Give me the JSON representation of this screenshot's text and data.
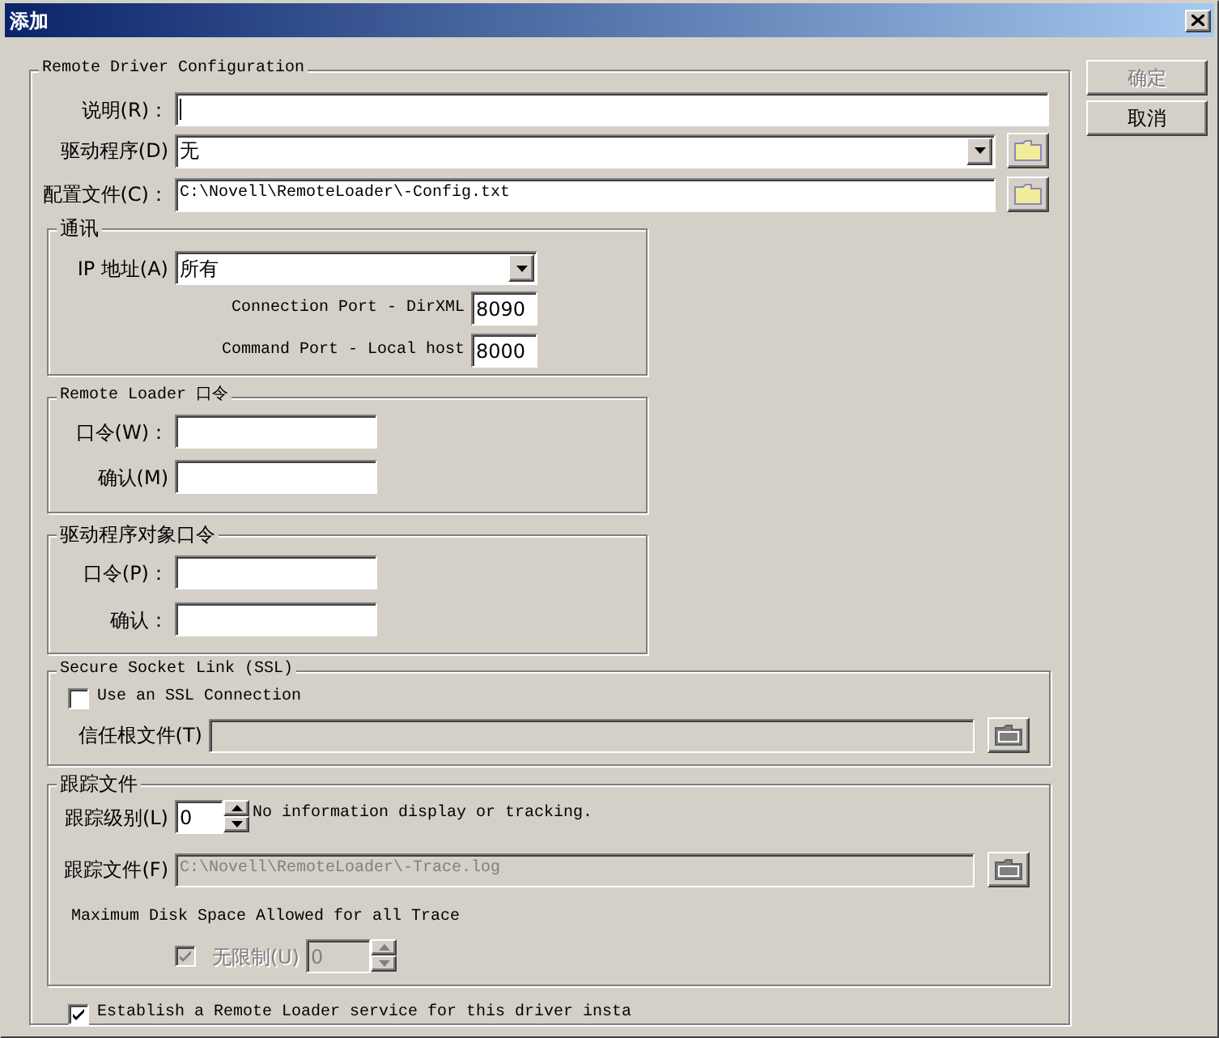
{
  "window": {
    "title": "添加"
  },
  "buttons": [
    {
      "label": "确定",
      "disabled": true
    },
    {
      "label": "取消",
      "disabled": false
    }
  ],
  "main_group": {
    "title": "Remote Driver Configuration"
  },
  "description": {
    "label": "说明(R)：",
    "focused": true
  },
  "driver": {
    "label": "驱动程序(D)",
    "value": "无"
  },
  "config_file": {
    "label": "配置文件(C)：",
    "value": "C:\\Novell\\RemoteLoader\\-Config.txt"
  },
  "communication": {
    "title": "通讯",
    "ip": {
      "label": "IP 地址(A)",
      "value": "所有"
    },
    "connection_port": {
      "label": "Connection Port - DirXML",
      "value": "8090"
    },
    "command_port": {
      "label": "Command Port - Local host",
      "value": "8000"
    }
  },
  "remote_loader_password": {
    "title": "Remote Loader 口令",
    "fields": [
      {
        "label": "口令(W)："
      },
      {
        "label": "确认(M)"
      }
    ]
  },
  "driver_object_password": {
    "title": "驱动程序对象口令",
    "fields": [
      {
        "label": "口令(P)："
      },
      {
        "label": "确认："
      }
    ]
  },
  "ssl": {
    "title": "Secure Socket Link (SSL)",
    "use_ssl": {
      "label": "Use an SSL Connection",
      "checked": false
    },
    "trusted_root": {
      "label": "信任根文件(T)",
      "disabled": true
    }
  },
  "trace": {
    "title": "跟踪文件",
    "level": {
      "label": "跟踪级别(L)",
      "value": "0",
      "description": "No information display or tracking."
    },
    "file": {
      "label": "跟踪文件(F)",
      "value": "C:\\Novell\\RemoteLoader\\-Trace.log",
      "disabled": true
    },
    "disk_space_title": "Maximum Disk Space Allowed for all Trace",
    "unlimited": {
      "label": "无限制(U)",
      "checked": true,
      "disabled": true
    },
    "size": {
      "value": "0",
      "disabled": true
    }
  },
  "establish_service": {
    "label": "Establish a Remote Loader service for this driver insta",
    "checked": true
  }
}
